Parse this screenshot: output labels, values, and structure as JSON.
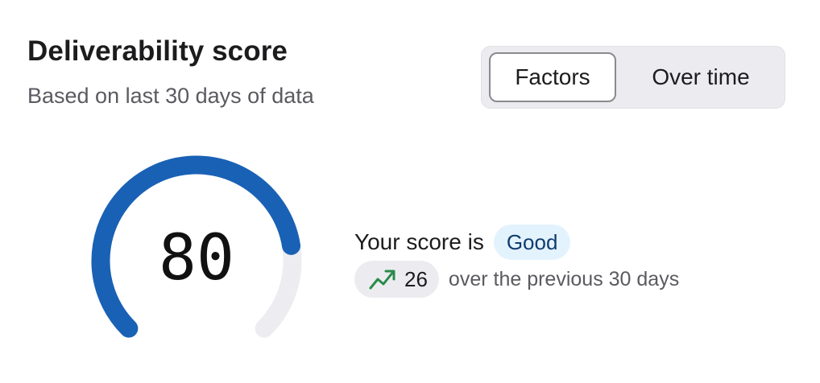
{
  "header": {
    "title": "Deliverability score",
    "subtitle": "Based on last 30 days of data"
  },
  "tabs": [
    {
      "label": "Factors",
      "selected": true
    },
    {
      "label": "Over time",
      "selected": false
    }
  ],
  "gauge": {
    "score": "80",
    "fill_fraction": 0.8,
    "fill_color": "#1961b5",
    "track_color": "#ededf1"
  },
  "summary": {
    "prefix": "Your score is",
    "rating": "Good",
    "trend_icon": "trending-up-icon",
    "trend_color": "#2a8a4a",
    "change": "26",
    "change_suffix": "over the previous 30 days"
  }
}
